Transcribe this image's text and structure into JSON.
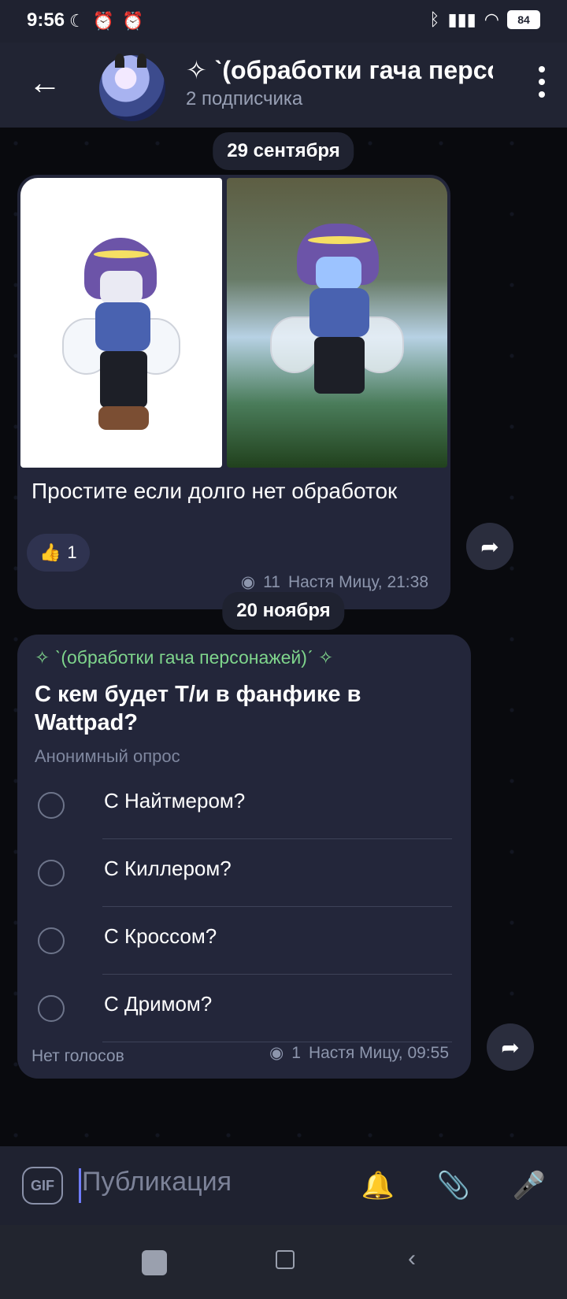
{
  "status": {
    "time": "9:56",
    "battery": "84"
  },
  "header": {
    "channel_title": "✧ ˋ(обработки гача персонажей)ˊ ✧",
    "subscribers": "2 подписчика"
  },
  "messages": [
    {
      "date": "29 сентября",
      "caption": "Простите если долго нет обработок",
      "reaction_count": "1",
      "views": "11",
      "author_time": "Настя Мицу, 21:38"
    },
    {
      "date": "20 ноября",
      "channel": "✧ ˋ(обработки гача персонажей)ˊ ✧",
      "question": "С кем будет Т/и в фанфике в Wattpad?",
      "type": "Анонимный опрос",
      "options": [
        "С Найтмером?",
        "С Киллером?",
        "С Кроссом?",
        "С Дримом?"
      ],
      "votes": "Нет голосов",
      "views": "1",
      "author_time": "Настя Мицу, 09:55"
    }
  ],
  "composer": {
    "gif_label": "GIF",
    "placeholder": "Публикация"
  },
  "colors": {
    "accent": "#6f7cff",
    "bubble": "#23263a",
    "green": "#7fd58c"
  },
  "icons": [
    "back-icon",
    "more-icon",
    "view-icon",
    "share-icon",
    "bell-icon",
    "paperclip-icon",
    "mic-icon"
  ]
}
